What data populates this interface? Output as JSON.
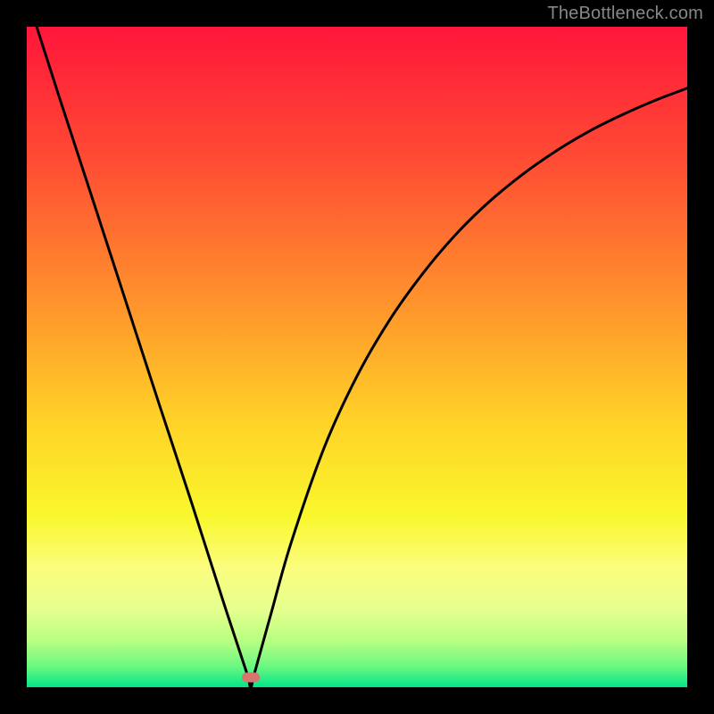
{
  "watermark": {
    "text": "TheBottleneck.com"
  },
  "plot": {
    "gradient_stops": [
      {
        "offset": 0.0,
        "color": "#ff163a"
      },
      {
        "offset": 0.2,
        "color": "#ff4b34"
      },
      {
        "offset": 0.42,
        "color": "#ff942c"
      },
      {
        "offset": 0.6,
        "color": "#ffd327"
      },
      {
        "offset": 0.74,
        "color": "#f9f72c"
      },
      {
        "offset": 0.82,
        "color": "#fbfd7e"
      },
      {
        "offset": 0.88,
        "color": "#e7ff8e"
      },
      {
        "offset": 0.93,
        "color": "#b8ff82"
      },
      {
        "offset": 0.97,
        "color": "#67f781"
      },
      {
        "offset": 1.0,
        "color": "#02e588"
      }
    ],
    "marker": {
      "x_frac": 0.339,
      "y_frac": 0.985,
      "color": "#d6766f"
    },
    "curve_stroke": "#000000",
    "curve_width": 3
  },
  "chart_data": {
    "type": "line",
    "title": "",
    "xlabel": "",
    "ylabel": "",
    "xlim": [
      0,
      1
    ],
    "ylim": [
      0,
      1
    ],
    "series": [
      {
        "name": "bottleneck-curve",
        "x": [
          0.015,
          0.05,
          0.1,
          0.15,
          0.2,
          0.25,
          0.3,
          0.333,
          0.339,
          0.345,
          0.37,
          0.4,
          0.45,
          0.5,
          0.55,
          0.6,
          0.65,
          0.7,
          0.75,
          0.8,
          0.85,
          0.9,
          0.95,
          1.0
        ],
        "y": [
          1.0,
          0.891,
          0.738,
          0.584,
          0.43,
          0.278,
          0.122,
          0.022,
          0.0,
          0.022,
          0.112,
          0.218,
          0.362,
          0.471,
          0.557,
          0.627,
          0.686,
          0.735,
          0.776,
          0.811,
          0.841,
          0.866,
          0.888,
          0.907
        ]
      }
    ],
    "annotations": [
      {
        "type": "marker",
        "x": 0.339,
        "y": 0.015,
        "color": "#d6766f",
        "shape": "pill"
      }
    ],
    "background": "rainbow-gradient-red-to-green"
  }
}
